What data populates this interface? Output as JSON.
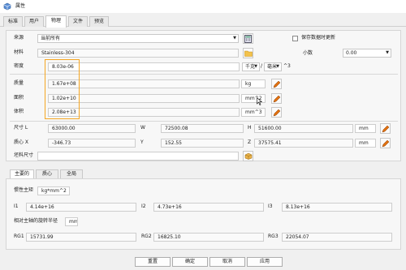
{
  "window": {
    "title": "属性"
  },
  "tabs": [
    "标准",
    "用户",
    "物理",
    "文件",
    "预览"
  ],
  "active_tab": "物理",
  "source": {
    "label": "来源",
    "value": "当前所有"
  },
  "save_checkbox": {
    "label": "保存数据时更新"
  },
  "material": {
    "label": "材料",
    "value": "Stainless-304"
  },
  "decimals": {
    "label": "小数",
    "value": "0.00"
  },
  "density": {
    "label": "密度",
    "value": "8.03e-06",
    "unit1": "千克",
    "unit2": "毫米",
    "unit_exp": "^3"
  },
  "mass": {
    "label": "质量",
    "value": "1.67e+08",
    "unit": "kg"
  },
  "area": {
    "label": "面积",
    "value": "1.02e+10",
    "unit": "mm^2"
  },
  "volume": {
    "label": "体积",
    "value": "2.08e+13",
    "unit": "mm^3"
  },
  "size": {
    "label": "尺寸 L",
    "l": "63000.00",
    "w_label": "W",
    "w": "72500.08",
    "h_label": "H",
    "h": "51600.00",
    "unit": "mm"
  },
  "centroid": {
    "label": "质心 X",
    "x": "-346.73",
    "y_label": "Y",
    "y": "152.55",
    "z_label": "Z",
    "z": "37575.41",
    "unit": "mm"
  },
  "stock": {
    "label": "坯料尺寸",
    "value": ""
  },
  "sub_tabs": [
    "主要的",
    "质心",
    "全局"
  ],
  "inertia": {
    "label": "惯性主矩",
    "unit": "kg*mm^2",
    "i1_label": "I1",
    "i1": "4.14e+16",
    "i2_label": "I2",
    "i2": "4.73e+16",
    "i3_label": "I3",
    "i3": "8.13e+16"
  },
  "gyration": {
    "label": "相对主轴的旋转半径",
    "unit": "mm",
    "rg1_label": "RG1",
    "rg1": "15731.99",
    "rg2_label": "RG2",
    "rg2": "16825.10",
    "rg3_label": "RG3",
    "rg3": "22054.07"
  },
  "buttons": {
    "reset": "重置",
    "ok": "确定",
    "cancel": "取消",
    "apply": "应用"
  },
  "colors": {
    "highlight": "#f5a623",
    "pencil": "#e07010"
  }
}
